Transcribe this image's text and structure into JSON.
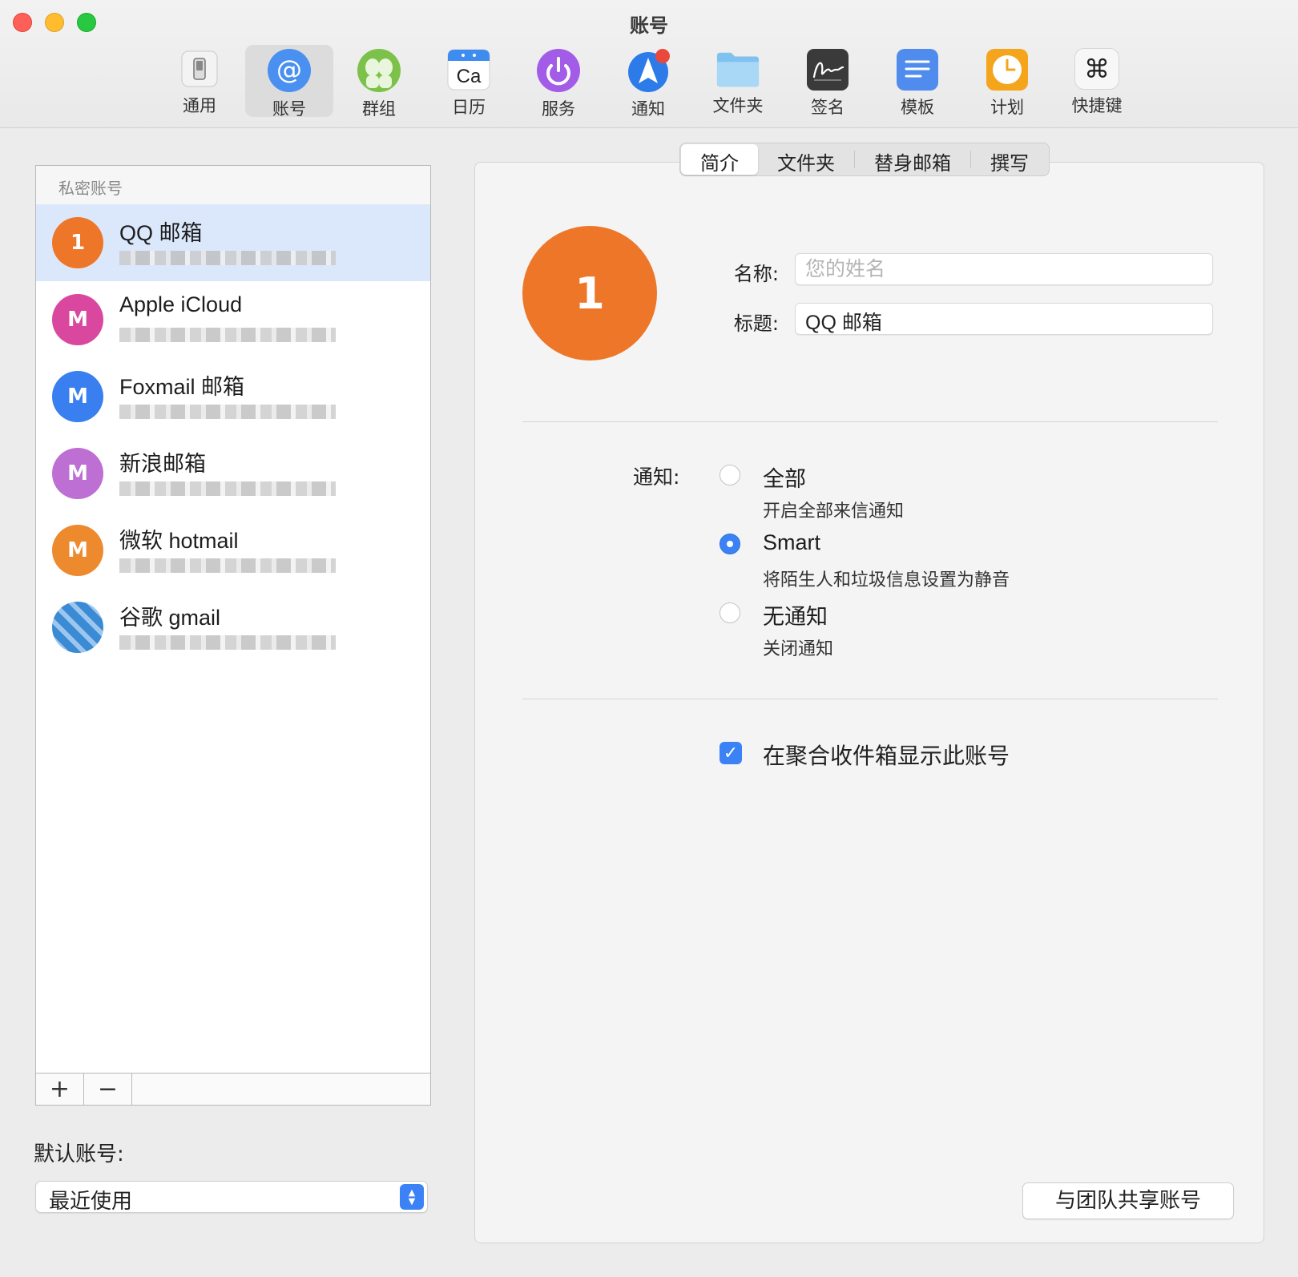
{
  "window": {
    "title": "账号"
  },
  "toolbar": [
    {
      "label": "通用",
      "icon": "phone-switch-icon"
    },
    {
      "label": "账号",
      "icon": "at-sign-icon"
    },
    {
      "label": "群组",
      "icon": "group-people-icon"
    },
    {
      "label": "日历",
      "icon": "calendar-icon",
      "glyph": "Ca"
    },
    {
      "label": "服务",
      "icon": "power-service-icon"
    },
    {
      "label": "通知",
      "icon": "notification-arrow-icon"
    },
    {
      "label": "文件夹",
      "icon": "folder-icon"
    },
    {
      "label": "签名",
      "icon": "signature-icon"
    },
    {
      "label": "模板",
      "icon": "template-icon"
    },
    {
      "label": "计划",
      "icon": "clock-icon"
    },
    {
      "label": "快捷键",
      "icon": "command-key-icon",
      "glyph": "⌘"
    }
  ],
  "accounts": {
    "header": "私密账号",
    "items": [
      {
        "initial": "1",
        "name": "QQ 邮箱",
        "color": "#ee7628",
        "selected": true
      },
      {
        "initial": "M",
        "name": "Apple iCloud",
        "color": "#d9479f",
        "selected": false
      },
      {
        "initial": "M",
        "name": "Foxmail 邮箱",
        "color": "#3a7ff0",
        "selected": false
      },
      {
        "initial": "M",
        "name": "新浪邮箱",
        "color": "#bd6fd3",
        "selected": false
      },
      {
        "initial": "M",
        "name": "微软 hotmail",
        "color": "#ee8a2e",
        "selected": false
      },
      {
        "initial": "",
        "name": "谷歌 gmail",
        "color": "#3b8bd4",
        "selected": false
      }
    ],
    "add_label": "+",
    "remove_label": "−"
  },
  "default_account": {
    "label": "默认账号:",
    "value": "最近使用"
  },
  "tabs": [
    {
      "label": "简介",
      "active": true
    },
    {
      "label": "文件夹",
      "active": false
    },
    {
      "label": "替身邮箱",
      "active": false
    },
    {
      "label": "撰写",
      "active": false
    }
  ],
  "profile": {
    "avatar_initial": "1",
    "avatar_color": "#ee7628",
    "name_label": "名称:",
    "name_placeholder": "您的姓名",
    "name_value": "",
    "title_label": "标题:",
    "title_value": "QQ 邮箱"
  },
  "notifications": {
    "label": "通知:",
    "options": [
      {
        "title": "全部",
        "desc": "开启全部来信通知",
        "selected": false
      },
      {
        "title": "Smart",
        "desc": "将陌生人和垃圾信息设置为静音",
        "selected": true
      },
      {
        "title": "无通知",
        "desc": "关闭通知",
        "selected": false
      }
    ]
  },
  "unified_inbox": {
    "label": "在聚合收件箱显示此账号",
    "checked": true
  },
  "share_button": "与团队共享账号",
  "colors": {
    "accent": "#3b82f6",
    "selected_row": "#dbe8fb"
  }
}
